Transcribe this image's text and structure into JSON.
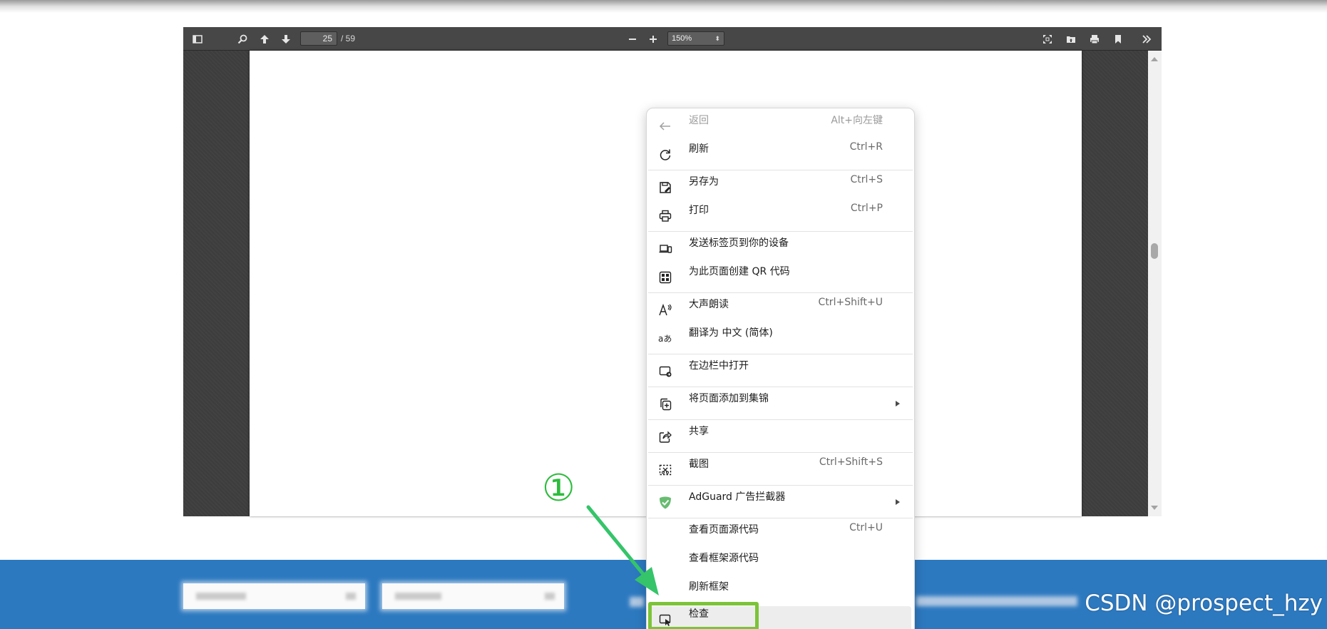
{
  "pdf_viewer": {
    "current_page": "25",
    "page_total": "/ 59",
    "zoom": "150%"
  },
  "context_menu": {
    "items": [
      {
        "icon": "back-arrow-icon",
        "label": "返回",
        "shortcut": "Alt+向左键"
      },
      {
        "icon": "refresh-icon",
        "label": "刷新",
        "shortcut": "Ctrl+R"
      },
      {
        "icon": "save-as-icon",
        "label": "另存为",
        "shortcut": "Ctrl+S"
      },
      {
        "icon": "print-icon",
        "label": "打印",
        "shortcut": "Ctrl+P"
      },
      {
        "icon": "send-to-device-icon",
        "label": "发送标签页到你的设备",
        "shortcut": ""
      },
      {
        "icon": "qr-code-icon",
        "label": "为此页面创建 QR 代码",
        "shortcut": ""
      },
      {
        "icon": "read-aloud-icon",
        "label": "大声朗读",
        "shortcut": "Ctrl+Shift+U"
      },
      {
        "icon": "translate-icon",
        "label": "翻译为 中文 (简体)",
        "shortcut": ""
      },
      {
        "icon": "sidebar-open-icon",
        "label": "在边栏中打开",
        "shortcut": ""
      },
      {
        "icon": "collections-add-icon",
        "label": "将页面添加到集锦",
        "shortcut": ""
      },
      {
        "icon": "share-icon",
        "label": "共享",
        "shortcut": ""
      },
      {
        "icon": "screenshot-icon",
        "label": "截图",
        "shortcut": "Ctrl+Shift+S"
      },
      {
        "icon": "adguard-shield-icon",
        "label": "AdGuard 广告拦截器",
        "shortcut": ""
      },
      {
        "icon": "",
        "label": "查看页面源代码",
        "shortcut": "Ctrl+U"
      },
      {
        "icon": "",
        "label": "查看框架源代码",
        "shortcut": ""
      },
      {
        "icon": "",
        "label": "刷新框架",
        "shortcut": ""
      },
      {
        "icon": "inspect-icon",
        "label": "检查",
        "shortcut": ""
      }
    ]
  },
  "annotation": {
    "step_number": "①",
    "color": "#2cbc3c",
    "highlight_color": "#7cc339"
  },
  "footer": {
    "watermark": "CSDN @prospect_hzy",
    "bar_color": "#2d79c0"
  }
}
